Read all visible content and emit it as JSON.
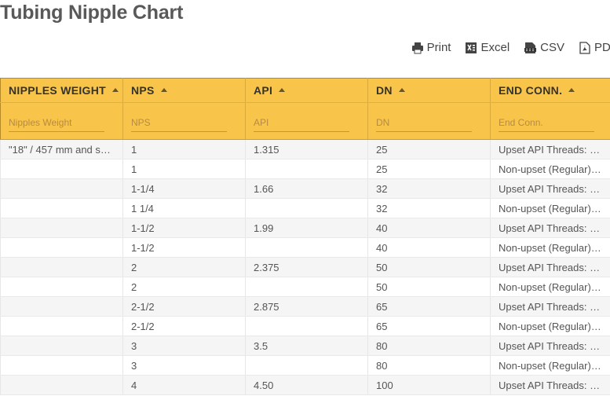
{
  "page": {
    "title": "Tubing Nipple Chart"
  },
  "toolbar": {
    "buttons": [
      {
        "label": "Print",
        "icon": "printer-icon"
      },
      {
        "label": "Excel",
        "icon": "excel-icon"
      },
      {
        "label": "CSV",
        "icon": "csv-icon"
      },
      {
        "label": "PDF",
        "icon": "pdf-icon"
      }
    ]
  },
  "table": {
    "header_color": "#f8c54a",
    "columns": [
      {
        "label": "NIPPLES WEIGHT",
        "placeholder": "Nipples Weight"
      },
      {
        "label": "NPS",
        "placeholder": "NPS"
      },
      {
        "label": "API",
        "placeholder": "API"
      },
      {
        "label": "DN",
        "placeholder": "DN"
      },
      {
        "label": "END CONN.",
        "placeholder": "End Conn."
      }
    ],
    "rows": [
      [
        "\"18\" / 457 mm and s…",
        "1",
        "1.315",
        "25",
        "Upset API Threads: …"
      ],
      [
        "",
        "1",
        "",
        "25",
        "Non-upset (Regular)…"
      ],
      [
        "",
        "1-1/4",
        "1.66",
        "32",
        "Upset API Threads: …"
      ],
      [
        "",
        "1 1/4",
        "",
        "32",
        "Non-upset (Regular)…"
      ],
      [
        "",
        "1-1/2",
        "1.99",
        "40",
        "Upset API Threads: …"
      ],
      [
        "",
        "1-1/2",
        "",
        "40",
        "Non-upset (Regular)…"
      ],
      [
        "",
        "2",
        "2.375",
        "50",
        "Upset API Threads: …"
      ],
      [
        "",
        "2",
        "",
        "50",
        "Non-upset (Regular)…"
      ],
      [
        "",
        "2-1/2",
        "2.875",
        "65",
        "Upset API Threads: …"
      ],
      [
        "",
        "2-1/2",
        "",
        "65",
        "Non-upset (Regular)…"
      ],
      [
        "",
        "3",
        "3.5",
        "80",
        "Upset API Threads: …"
      ],
      [
        "",
        "3",
        "",
        "80",
        "Non-upset (Regular)…"
      ],
      [
        "",
        "4",
        "4.50",
        "100",
        "Upset API Threads: …"
      ]
    ]
  }
}
